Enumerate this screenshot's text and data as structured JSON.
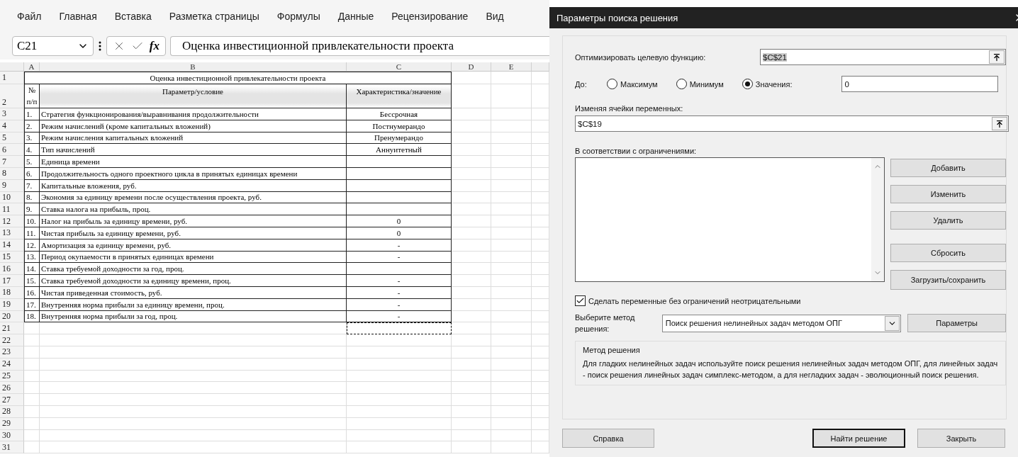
{
  "menu": [
    "Файл",
    "Главная",
    "Вставка",
    "Разметка страницы",
    "Формулы",
    "Данные",
    "Рецензирование",
    "Вид"
  ],
  "formula_bar": {
    "name_box": "C21",
    "function_label": "fx",
    "content": "Оценка инвестиционной привлекательности проекта"
  },
  "sheet": {
    "columns": [
      "A",
      "B",
      "C",
      "D",
      "E"
    ],
    "title_row": {
      "row_number": "1",
      "text": "Оценка инвестиционной привлекательности проекта"
    },
    "header_row": {
      "row_number": "2",
      "number": "№ п/п",
      "parameter": "Параметр/условие",
      "value": "Характеристика/значение"
    },
    "rows": [
      {
        "row_number": "3",
        "number": "1.",
        "parameter": "Стратегия функционирования/выравнивания продолжительности",
        "value": "Бессрочная",
        "marquee": false
      },
      {
        "row_number": "4",
        "number": "2.",
        "parameter": "Режим начислений (кроме капитальных вложений)",
        "value": "Постнумерандо",
        "marquee": false
      },
      {
        "row_number": "5",
        "number": "3.",
        "parameter": "Режим начисления капитальных вложений",
        "value": "Пренумерандо",
        "marquee": false
      },
      {
        "row_number": "6",
        "number": "4.",
        "parameter": "Тип начислений",
        "value": "Аннуитетный",
        "marquee": false
      },
      {
        "row_number": "7",
        "number": "5.",
        "parameter": "Единица времени",
        "marquee": false
      },
      {
        "row_number": "8",
        "number": "6.",
        "parameter": "Продолжительность одного проектного цикла в принятых единицах времени",
        "marquee": false
      },
      {
        "row_number": "9",
        "number": "7.",
        "parameter": "Капитальные вложения, руб.",
        "marquee": false
      },
      {
        "row_number": "10",
        "number": "8.",
        "parameter": "Экономия за единицу времени после осуществления проекта, руб.",
        "marquee": false
      },
      {
        "row_number": "11",
        "number": "9.",
        "parameter": "Ставка налога на прибыль, проц.",
        "marquee": false
      },
      {
        "row_number": "12",
        "number": "10.",
        "parameter": "Налог на прибыль за единицу времени, руб.",
        "value": "0",
        "marquee": false
      },
      {
        "row_number": "13",
        "number": "11.",
        "parameter": "Чистая прибыль за единицу времени, руб.",
        "value": "0",
        "marquee": false
      },
      {
        "row_number": "14",
        "number": "12.",
        "parameter": "Амортизация за единицу времени, руб.",
        "value": "-",
        "marquee": false
      },
      {
        "row_number": "15",
        "number": "13.",
        "parameter": "Период окупаемости в принятых единицах времени",
        "value": "-",
        "marquee": false
      },
      {
        "row_number": "16",
        "number": "14.",
        "parameter": "Ставка требуемой доходности за год, проц.",
        "marquee": false
      },
      {
        "row_number": "17",
        "number": "15.",
        "parameter": "Ставка требуемой доходности за единицу времени, проц.",
        "value": "-",
        "marquee": false
      },
      {
        "row_number": "18",
        "number": "16.",
        "parameter": "Чистая приведенная стоимость, руб.",
        "value": "-",
        "marquee": false
      },
      {
        "row_number": "19",
        "number": "17.",
        "parameter": "Внутренняя норма прибыли за единицу времени, проц.",
        "value": "-",
        "marquee": false
      },
      {
        "row_number": "20",
        "number": "18.",
        "parameter": "Внутренняя норма прибыли за год, проц.",
        "value": "-",
        "marquee": false
      },
      {
        "row_number": "21",
        "marquee": true
      },
      {
        "row_number": "22",
        "marquee": false
      },
      {
        "row_number": "23",
        "marquee": false
      },
      {
        "row_number": "24",
        "marquee": false
      },
      {
        "row_number": "25",
        "marquee": false
      },
      {
        "row_number": "26",
        "marquee": false
      },
      {
        "row_number": "27",
        "marquee": false
      },
      {
        "row_number": "28",
        "marquee": false
      },
      {
        "row_number": "29",
        "marquee": false
      },
      {
        "row_number": "30",
        "marquee": false
      },
      {
        "row_number": "31",
        "marquee": false
      }
    ]
  },
  "dialog": {
    "title": "Параметры поиска решения",
    "objective": {
      "label": "Оптимизировать целевую функцию:",
      "value": "$C$21"
    },
    "target": {
      "label": "До:",
      "options": [
        {
          "label": "Максимум",
          "selected": false
        },
        {
          "label": "Минимум",
          "selected": false
        },
        {
          "label": "Значения:",
          "selected": true
        }
      ],
      "value": "0"
    },
    "variables": {
      "label": "Изменяя ячейки переменных:",
      "value": "$C$19"
    },
    "constraints": {
      "label": "В соответствии с ограничениями:"
    },
    "side_buttons": [
      "Добавить",
      "Изменить",
      "Удалить",
      "Сбросить",
      "Загрузить/сохранить"
    ],
    "nonnegative": {
      "label": "Сделать переменные без ограничений неотрицательными",
      "checked": true
    },
    "method": {
      "label": "Выберите метод решения:",
      "value": "Поиск решения нелинейных задач методом ОПГ",
      "options_button": "Параметры"
    },
    "description": {
      "title": "Метод решения",
      "text": "Для гладких нелинейных задач используйте поиск решения нелинейных задач методом ОПГ, для линейных задач - поиск решения линейных задач симплекс-методом, а для негладких задач - эволюционный поиск решения."
    },
    "footer_buttons": [
      {
        "label": "Справка",
        "default": false
      },
      {
        "label": "Найти решение",
        "default": true
      },
      {
        "label": "Закрыть",
        "default": false
      }
    ]
  }
}
